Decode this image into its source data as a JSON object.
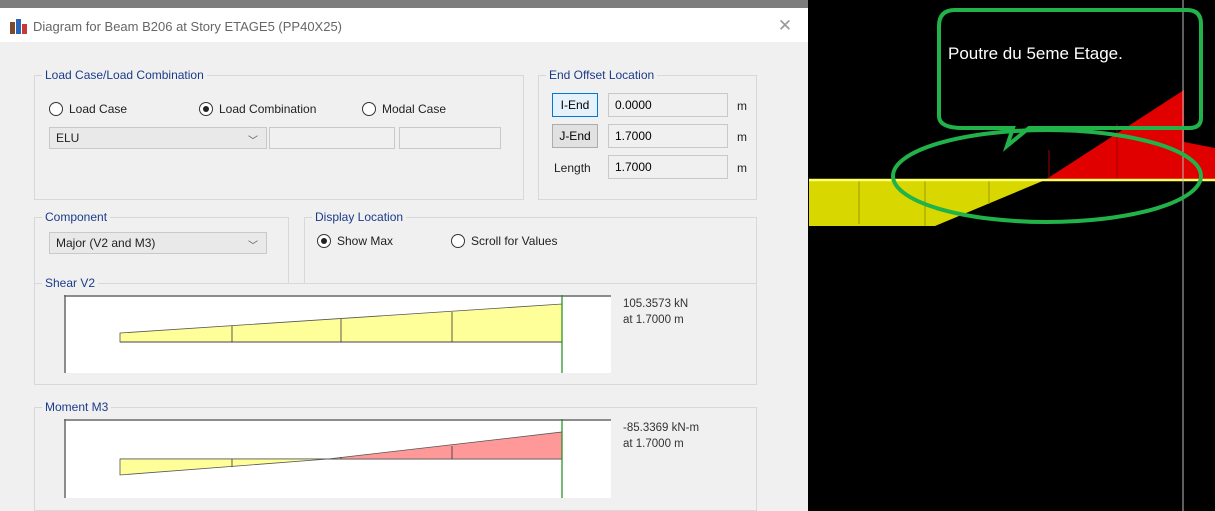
{
  "window": {
    "title": "Diagram for Beam B206 at Story ETAGE5 (PP40X25)"
  },
  "load_case": {
    "legend": "Load Case/Load Combination",
    "options": [
      "Load Case",
      "Load Combination",
      "Modal Case"
    ],
    "selected": "Load Combination",
    "combo_value": "ELU"
  },
  "end_offset": {
    "legend": "End Offset Location",
    "i_end_label": "I-End",
    "i_end_value": "0.0000",
    "j_end_label": "J-End",
    "j_end_value": "1.7000",
    "length_label": "Length",
    "length_value": "1.7000",
    "unit": "m"
  },
  "component": {
    "legend": "Component",
    "value": "Major (V2 and M3)"
  },
  "display_location": {
    "legend": "Display Location",
    "options": [
      "Show Max",
      "Scroll for Values"
    ],
    "selected": "Show Max"
  },
  "shear": {
    "legend": "Shear V2",
    "max_value": "105.3573 kN",
    "max_location": "at 1.7000 m"
  },
  "moment": {
    "legend": "Moment M3",
    "max_value": "-85.3369 kN-m",
    "max_location": "at 1.7000 m"
  },
  "model_view": {
    "callout": "Poutre du 5eme Etage."
  },
  "colors": {
    "positive_fill": "#ffff99",
    "negative_fill": "#ff9999",
    "model_yellow": "#d8d800",
    "model_red": "#e00000",
    "callout_green": "#21b24a"
  }
}
